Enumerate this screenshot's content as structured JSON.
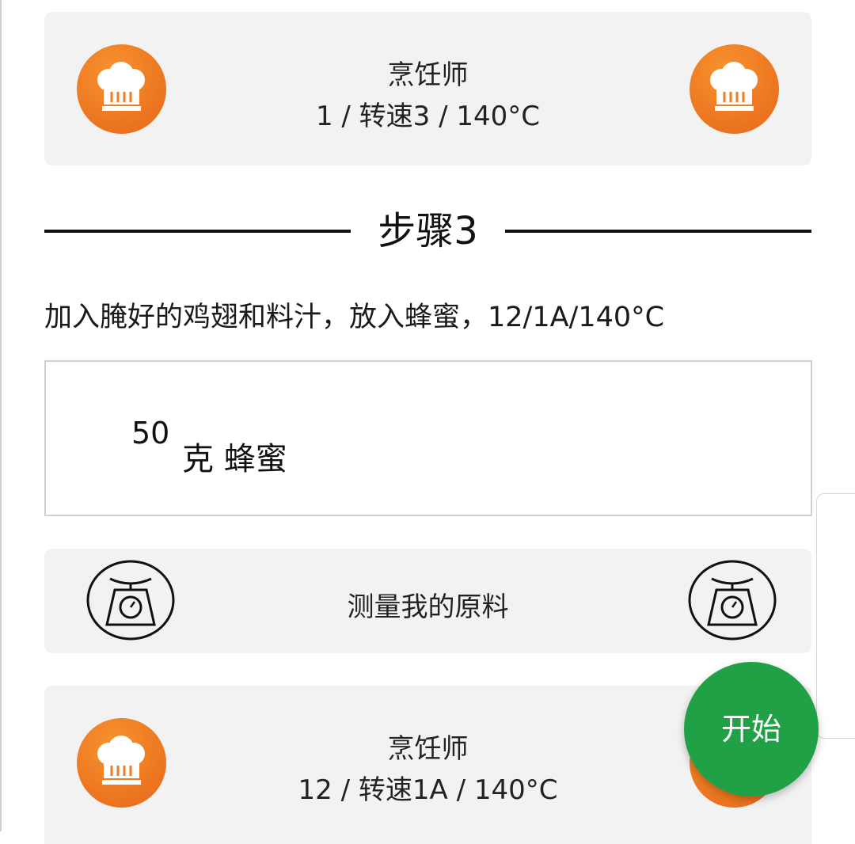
{
  "cook_card_top": {
    "title": "烹饪师",
    "setting": "1 / 转速3 / 140°C",
    "icon_left": "chef-hat-icon",
    "icon_right": "chef-hat-icon"
  },
  "step": {
    "title": "步骤3",
    "description": "加入腌好的鸡翅和料汁，放入蜂蜜，12/1A/140°C"
  },
  "ingredient": {
    "quantity": "50",
    "name": "克 蜂蜜"
  },
  "measure_card": {
    "label": "测量我的原料",
    "icon_left": "scale-icon",
    "icon_right": "scale-icon"
  },
  "cook_card_bottom": {
    "title": "烹饪师",
    "setting": "12 / 转速1A / 140°C",
    "icon_left": "chef-hat-icon",
    "icon_right": "chef-hat-icon"
  },
  "fab": {
    "label": "开始"
  },
  "colors": {
    "accent_orange": "#ee7a22",
    "start_green": "#21a146",
    "card_bg": "#f2f2f2"
  }
}
